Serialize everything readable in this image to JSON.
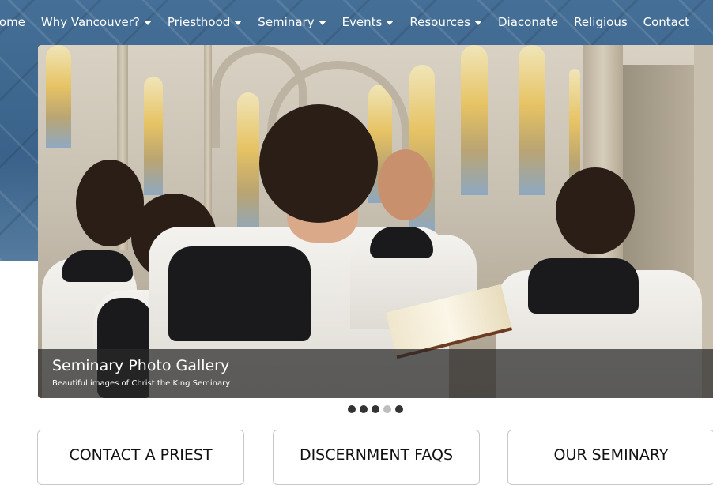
{
  "nav": {
    "items": [
      {
        "label": "Home",
        "dropdown": false
      },
      {
        "label": "Why Vancouver?",
        "dropdown": true
      },
      {
        "label": "Priesthood",
        "dropdown": true
      },
      {
        "label": "Seminary",
        "dropdown": true
      },
      {
        "label": "Events",
        "dropdown": true
      },
      {
        "label": "Resources",
        "dropdown": true
      },
      {
        "label": "Diaconate",
        "dropdown": false
      },
      {
        "label": "Religious",
        "dropdown": false
      },
      {
        "label": "Contact",
        "dropdown": false
      }
    ]
  },
  "slider": {
    "caption_title": "Seminary Photo Gallery",
    "caption_subtitle": "Beautiful images of Christ the King Seminary",
    "slide_count": 5,
    "active_slide": 4
  },
  "cards": [
    {
      "title": "CONTACT A PRIEST"
    },
    {
      "title": "DISCERNMENT FAQS"
    },
    {
      "title": "OUR SEMINARY"
    }
  ],
  "colors": {
    "band": "#3e6a93",
    "caption_bg": "#282828",
    "dot": "#333333",
    "dot_active": "#bdbdbd"
  }
}
